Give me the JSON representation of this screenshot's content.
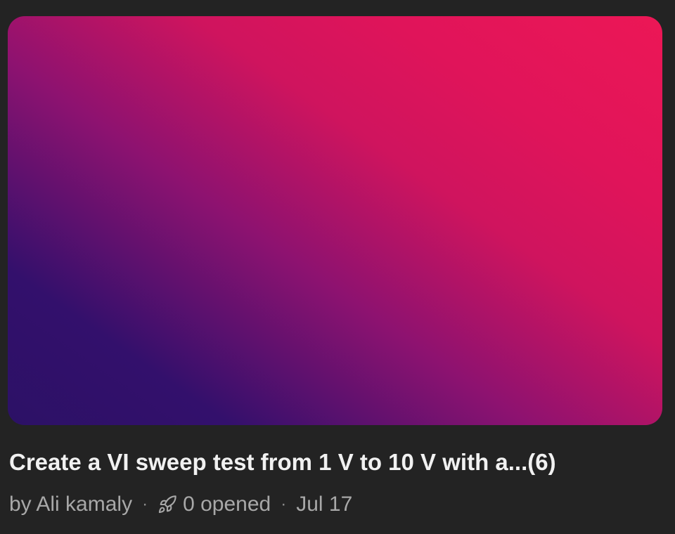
{
  "card": {
    "title": "Create a VI sweep test from 1 V to 10 V with a...(6)",
    "author": "by Ali kamaly",
    "separator": "·",
    "opened": "0 opened",
    "date": "Jul 17",
    "opened_icon": "rocket-icon"
  },
  "colors": {
    "background": "#232323",
    "gradient_start": "#2c1166",
    "gradient_end": "#ec1756",
    "title": "#f1f1f1",
    "meta": "#a8a8a8"
  }
}
